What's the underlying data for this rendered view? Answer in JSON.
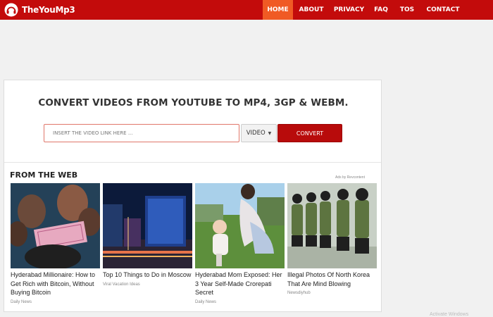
{
  "brand": {
    "name": "TheYouMp3"
  },
  "nav": {
    "items": [
      {
        "label": "HOME",
        "active": true
      },
      {
        "label": "ABOUT",
        "active": false
      },
      {
        "label": "PRIVACY",
        "active": false
      },
      {
        "label": "FAQ",
        "active": false
      },
      {
        "label": "TOS",
        "active": false
      },
      {
        "label": "CONTACT",
        "active": false
      }
    ]
  },
  "converter": {
    "headline": "CONVERT VIDEOS FROM YOUTUBE TO MP4, 3GP & WEBM.",
    "placeholder": "INSERT THE VIDEO LINK HERE ...",
    "value": "",
    "format_selected": "VIDEO",
    "convert_label": "CONVERT"
  },
  "feed": {
    "title": "FROM THE WEB",
    "ads_by": "Ads by Revcontent",
    "cards": [
      {
        "title": "Hyderabad Millionaire: How to Get Rich with Bitcoin, Without Buying Bitcoin",
        "source": "Daily News"
      },
      {
        "title": "Top 10 Things to Do in Moscow",
        "source": "Viral Vacation Ideas"
      },
      {
        "title": "Hyderabad Mom Exposed: Her 3 Year Self-Made Crorepati Secret",
        "source": "Daily News"
      },
      {
        "title": "Illegal Photos Of North Korea That Are Mind Blowing",
        "source": "Newsdiyhub"
      }
    ]
  },
  "watermark": "Activate Windows",
  "colors": {
    "brand_red": "#c30b0b",
    "nav_active": "#f05a24",
    "convert": "#b80b0b"
  }
}
